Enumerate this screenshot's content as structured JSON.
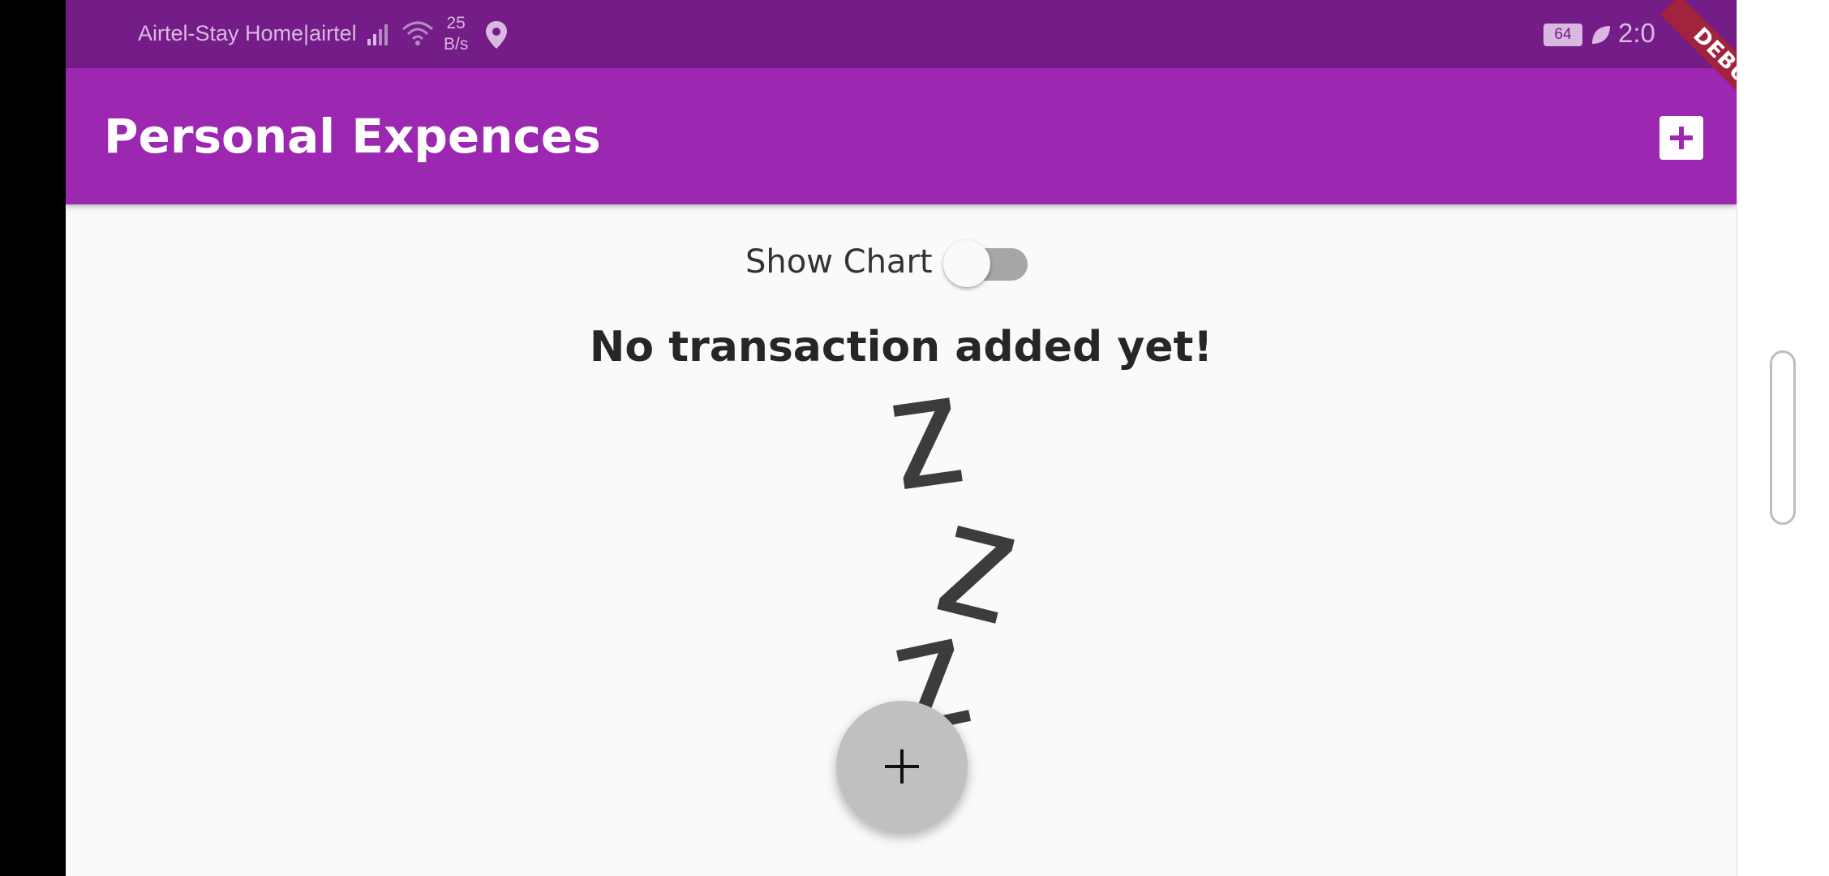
{
  "status_bar": {
    "carrier": "Airtel-Stay Home|airtel",
    "net_speed_value": "25",
    "net_speed_unit": "B/s",
    "battery_level": "64",
    "time": "2:0",
    "icons": [
      "signal-icon",
      "wifi-icon",
      "location-icon",
      "battery-icon",
      "leaf-icon"
    ]
  },
  "app_bar": {
    "title": "Personal Expences",
    "action_icon": "add-box-icon"
  },
  "debug_banner": "DEBUG",
  "chart_toggle": {
    "label": "Show Chart",
    "value": false
  },
  "empty_state": {
    "message": "No transaction added yet!",
    "image": "sleeping-zzz-image"
  },
  "fab": {
    "icon": "add-icon"
  },
  "colors": {
    "status_bar": "#741c87",
    "app_bar": "#9c27b0",
    "background": "#fafafa",
    "fab": "#c0c0c0",
    "debug_banner": "#a2233d"
  }
}
